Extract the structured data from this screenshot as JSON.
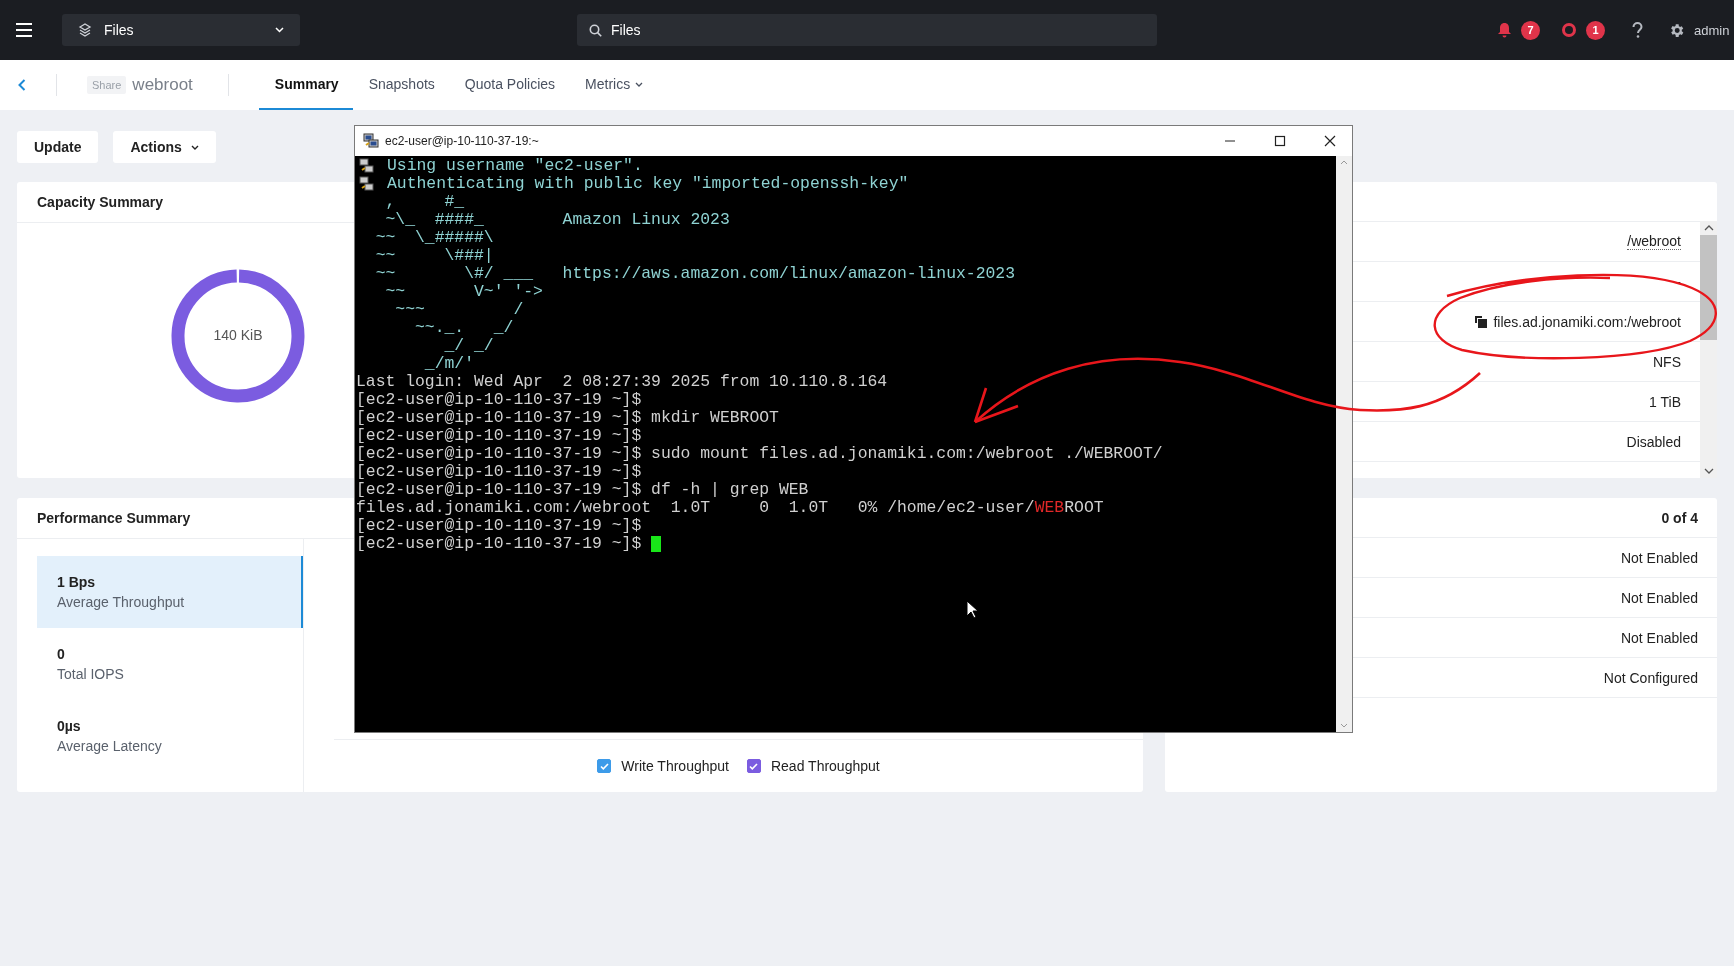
{
  "topbar": {
    "app_selector": "Files",
    "search": {
      "value": "Files"
    },
    "alerts": [
      {
        "kind": "bell",
        "count": "7"
      },
      {
        "kind": "ring",
        "count": "1"
      }
    ],
    "user": "admin"
  },
  "subnav": {
    "entity_type": "Share",
    "entity_name": "webroot",
    "tabs": [
      {
        "label": "Summary",
        "selected": true,
        "has_menu": false
      },
      {
        "label": "Snapshots",
        "selected": false,
        "has_menu": false
      },
      {
        "label": "Quota Policies",
        "selected": false,
        "has_menu": false
      },
      {
        "label": "Metrics",
        "selected": false,
        "has_menu": true
      }
    ]
  },
  "actions": [
    {
      "label": "Update",
      "has_menu": false
    },
    {
      "label": "Actions",
      "has_menu": true
    }
  ],
  "capacity": {
    "title": "Capacity Summary",
    "used": "140 KiB"
  },
  "performance": {
    "title": "Performance Summary",
    "metrics": [
      {
        "value": "1 Bps",
        "label": "Average Throughput",
        "selected": true
      },
      {
        "value": "0",
        "label": "Total IOPS",
        "selected": false
      },
      {
        "value": "0µs",
        "label": "Average Latency",
        "selected": false
      }
    ],
    "legend": [
      {
        "label": "Write Throughput",
        "checked": true,
        "color": "#3d9be9"
      },
      {
        "label": "Read Throughput",
        "checked": true,
        "color": "#7b5ce0"
      }
    ]
  },
  "share_details": [
    {
      "text": "/webroot",
      "kind": "path"
    },
    {
      "text": "-",
      "kind": "plain"
    },
    {
      "text": "files.ad.jonamiki.com:/webroot",
      "kind": "copy"
    },
    {
      "text": "NFS",
      "kind": "plain"
    },
    {
      "text": "1 TiB",
      "kind": "plain"
    },
    {
      "text": "Disabled",
      "kind": "plain"
    }
  ],
  "features": [
    {
      "text": "0 of 4",
      "kind": "count"
    },
    {
      "text": "Not Enabled",
      "kind": "plain"
    },
    {
      "text": "Not Enabled",
      "kind": "plain"
    },
    {
      "text": "Not Enabled",
      "kind": "plain"
    },
    {
      "text": "Not Configured",
      "kind": "plain"
    }
  ],
  "terminal": {
    "title": "ec2-user@ip-10-110-37-19:~",
    "lines": [
      {
        "kind": "info",
        "text": "Using username \"ec2-user\"."
      },
      {
        "kind": "info",
        "text": "Authenticating with public key \"imported-openssh-key\""
      },
      {
        "kind": "banner",
        "text": "   ,     #_"
      },
      {
        "kind": "banner",
        "text": "   ~\\_  ####_        Amazon Linux 2023"
      },
      {
        "kind": "banner",
        "text": "  ~~  \\_#####\\"
      },
      {
        "kind": "banner",
        "text": "  ~~     \\###|"
      },
      {
        "kind": "banner",
        "text": "  ~~       \\#/ ___   https://aws.amazon.com/linux/amazon-linux-2023"
      },
      {
        "kind": "banner",
        "text": "   ~~       V~' '->"
      },
      {
        "kind": "banner",
        "text": "    ~~~         /"
      },
      {
        "kind": "banner",
        "text": "      ~~._.   _/"
      },
      {
        "kind": "banner",
        "text": "         _/ _/"
      },
      {
        "kind": "banner",
        "text": "       _/m/'"
      },
      {
        "kind": "session",
        "text": "Last login: Wed Apr  2 08:27:39 2025 from 10.110.8.164"
      },
      {
        "kind": "session",
        "text": "[ec2-user@ip-10-110-37-19 ~]$"
      },
      {
        "kind": "session",
        "text": "[ec2-user@ip-10-110-37-19 ~]$ mkdir WEBROOT"
      },
      {
        "kind": "session",
        "text": "[ec2-user@ip-10-110-37-19 ~]$"
      },
      {
        "kind": "session",
        "text": "[ec2-user@ip-10-110-37-19 ~]$ sudo mount files.ad.jonamiki.com:/webroot ./WEBROOT/"
      },
      {
        "kind": "session",
        "text": "[ec2-user@ip-10-110-37-19 ~]$"
      },
      {
        "kind": "session",
        "text": "[ec2-user@ip-10-110-37-19 ~]$ df -h | grep WEB"
      },
      {
        "kind": "session",
        "segments": [
          {
            "text": "files.ad.jonamiki.com:/webroot  1.0T     0  1.0T   0% /home/ec2-user/",
            "match": false
          },
          {
            "text": "WEB",
            "match": true
          },
          {
            "text": "ROOT",
            "match": false
          }
        ]
      },
      {
        "kind": "session",
        "text": "[ec2-user@ip-10-110-37-19 ~]$"
      },
      {
        "kind": "prompt",
        "text": "[ec2-user@ip-10-110-37-19 ~]$ "
      }
    ]
  }
}
